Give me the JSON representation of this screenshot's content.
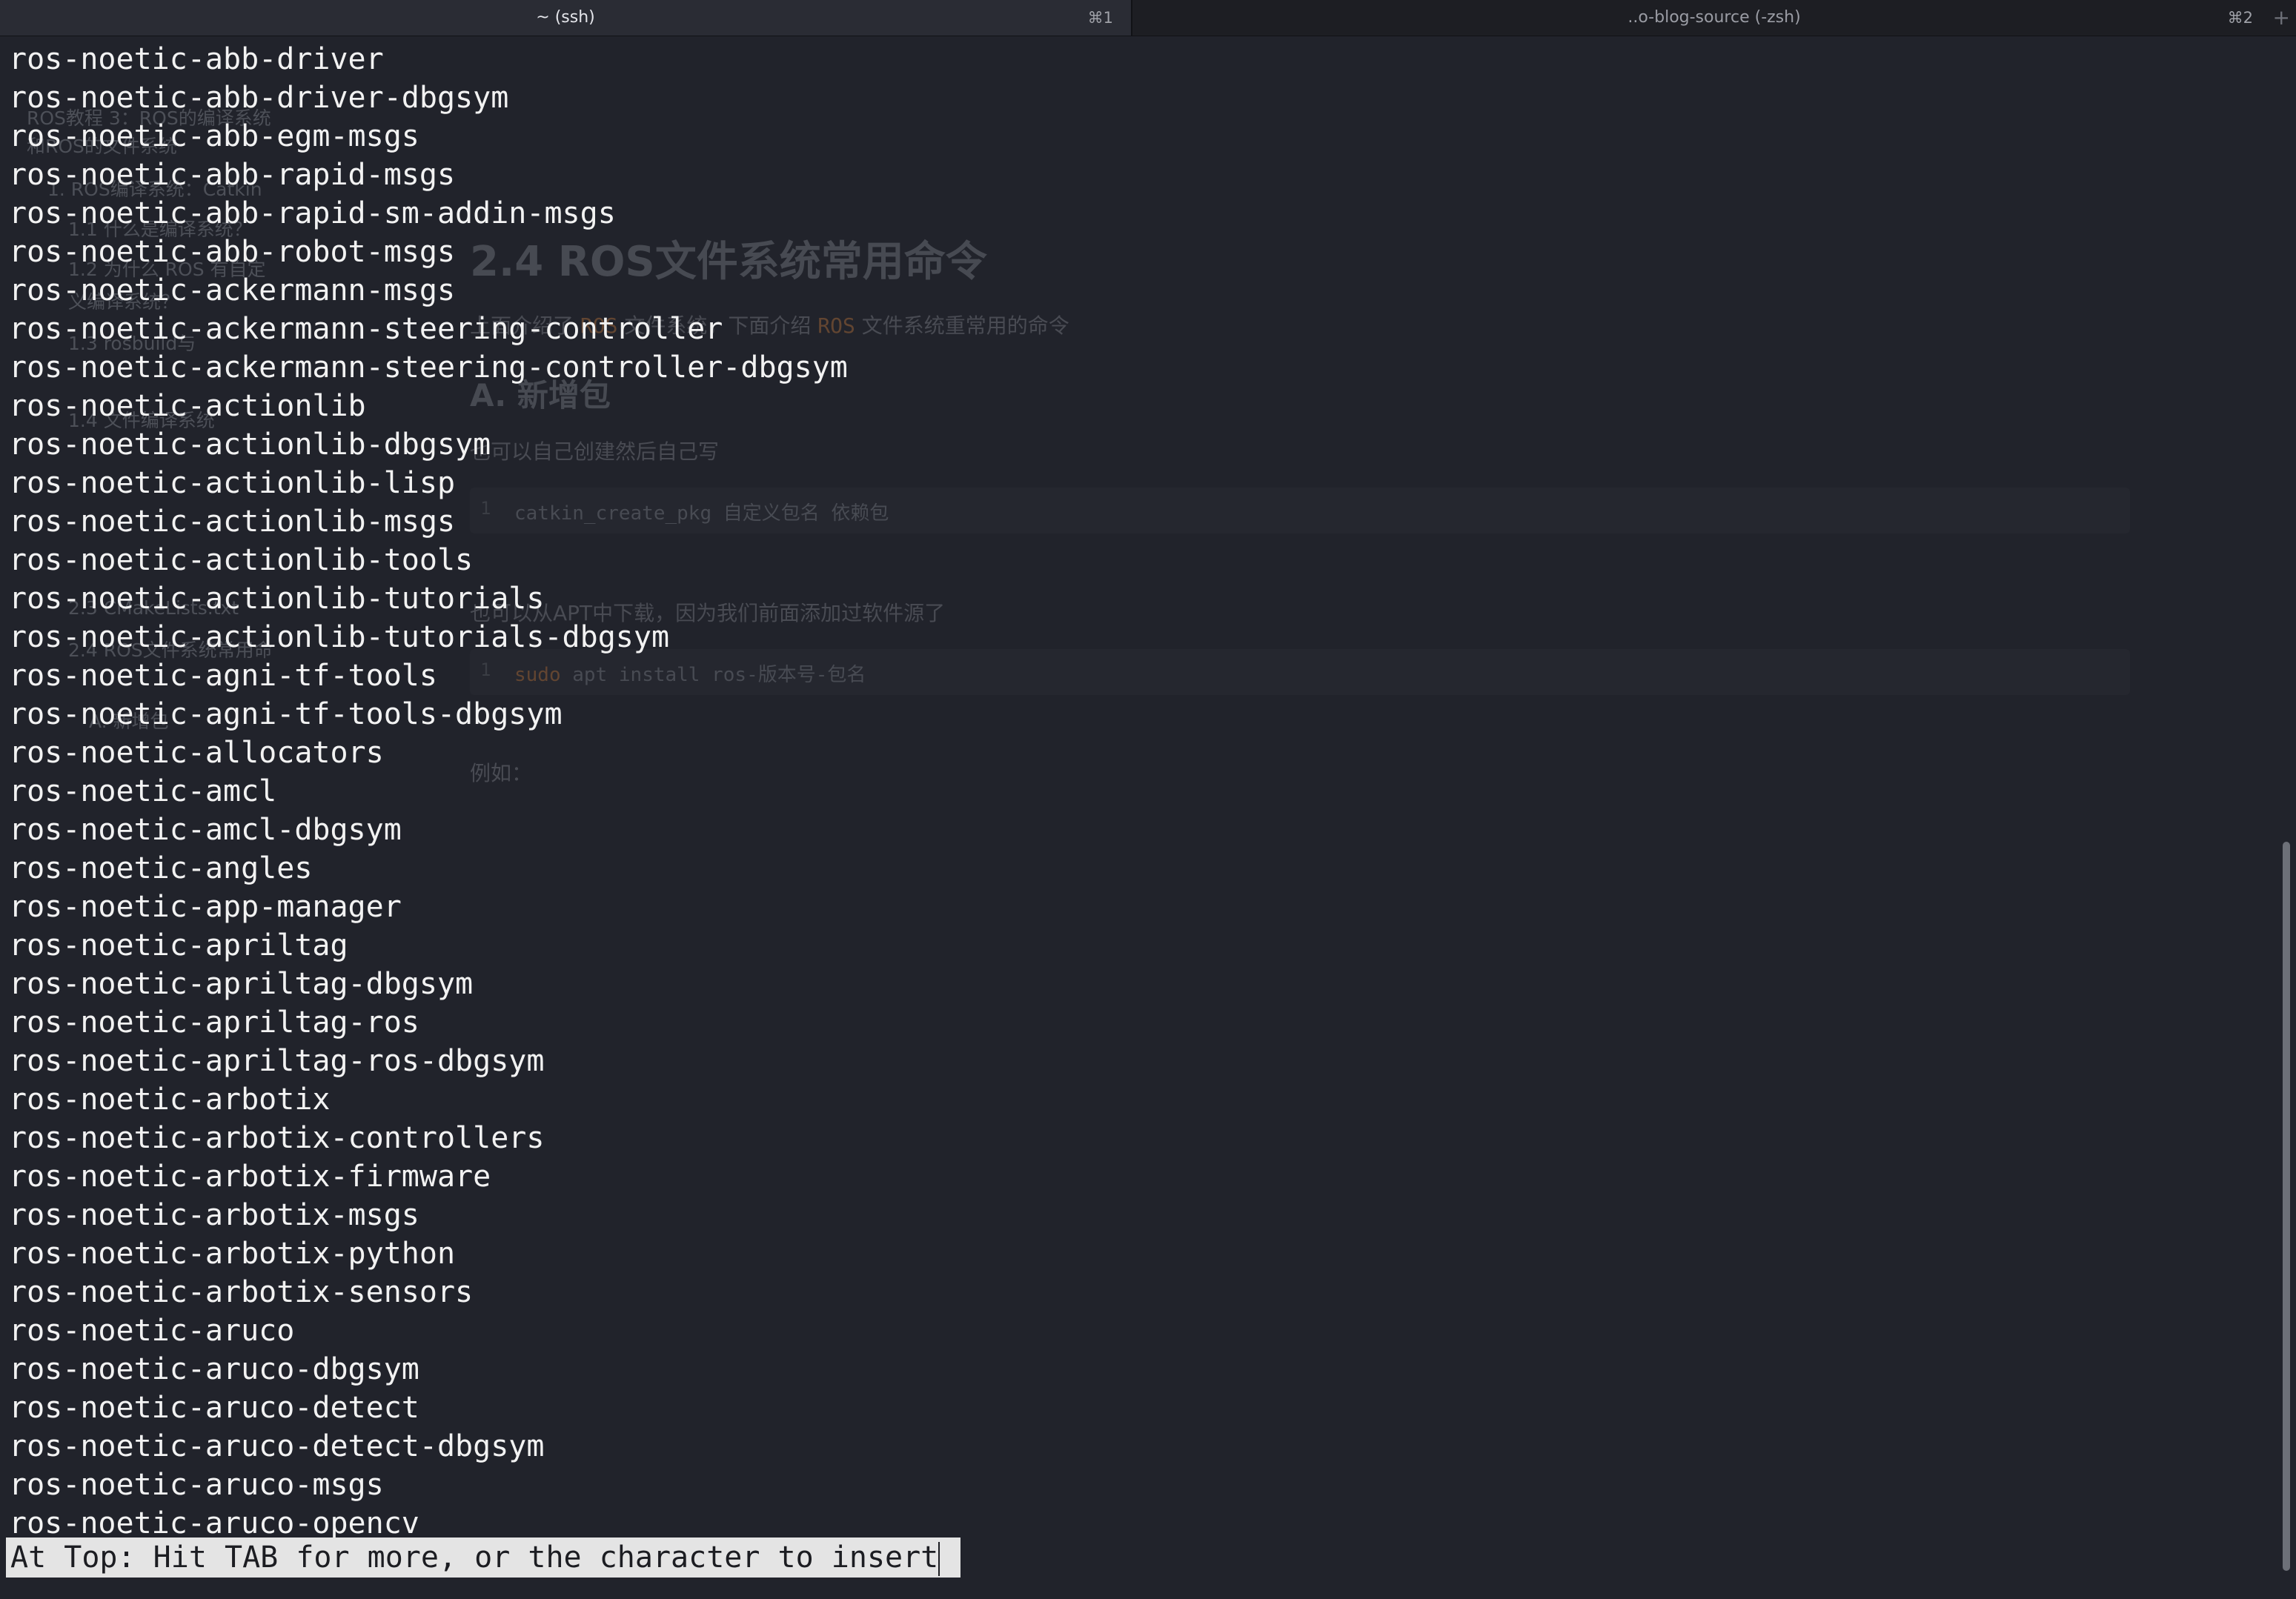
{
  "tabs": [
    {
      "title": "~ (ssh)",
      "shortcut": "⌘1",
      "active": true
    },
    {
      "title": "..o-blog-source (-zsh)",
      "shortcut": "⌘2",
      "active": false
    }
  ],
  "new_tab_label": "+",
  "background_doc": {
    "toc": [
      "ROS教程 3：ROS的编译系统",
      "和ROS的文件系统",
      "1. ROS编译系统：Catkin",
      "1.1 什么是编译系统？",
      "1.2 为什么 ROS 有自定",
      "义编译系统？",
      "1.3 rosbuild与",
      "1.4 文件编译系统",
      "2.3 CMakeLists.txt",
      "2.4 ROS文件系统常用命",
      "A. 新增包"
    ],
    "heading": "2.4 ROS文件系统常用命令",
    "intro_prefix": "上面介绍了 ",
    "intro_ros1": "ROS",
    "intro_middle": " 文件系统，下面介绍 ",
    "intro_ros2": "ROS",
    "intro_suffix": " 文件系统重常用的命令",
    "subheading": "A. 新增包",
    "para1": "也可以自己创建然后自己写",
    "code1_line": "1",
    "code1": "catkin_create_pkg 自定义包名 依赖包",
    "para2": "也可以从APT中下载，因为我们前面添加过软件源了",
    "code2_line": "1",
    "code2_kw": "sudo",
    "code2_rest": " apt install ros-版本号-包名",
    "para3": "例如："
  },
  "terminal": {
    "lines": [
      "ros-noetic-abb-driver",
      "ros-noetic-abb-driver-dbgsym",
      "ros-noetic-abb-egm-msgs",
      "ros-noetic-abb-rapid-msgs",
      "ros-noetic-abb-rapid-sm-addin-msgs",
      "ros-noetic-abb-robot-msgs",
      "ros-noetic-ackermann-msgs",
      "ros-noetic-ackermann-steering-controller",
      "ros-noetic-ackermann-steering-controller-dbgsym",
      "ros-noetic-actionlib",
      "ros-noetic-actionlib-dbgsym",
      "ros-noetic-actionlib-lisp",
      "ros-noetic-actionlib-msgs",
      "ros-noetic-actionlib-tools",
      "ros-noetic-actionlib-tutorials",
      "ros-noetic-actionlib-tutorials-dbgsym",
      "ros-noetic-agni-tf-tools",
      "ros-noetic-agni-tf-tools-dbgsym",
      "ros-noetic-allocators",
      "ros-noetic-amcl",
      "ros-noetic-amcl-dbgsym",
      "ros-noetic-angles",
      "ros-noetic-app-manager",
      "ros-noetic-apriltag",
      "ros-noetic-apriltag-dbgsym",
      "ros-noetic-apriltag-ros",
      "ros-noetic-apriltag-ros-dbgsym",
      "ros-noetic-arbotix",
      "ros-noetic-arbotix-controllers",
      "ros-noetic-arbotix-firmware",
      "ros-noetic-arbotix-msgs",
      "ros-noetic-arbotix-python",
      "ros-noetic-arbotix-sensors",
      "ros-noetic-aruco",
      "ros-noetic-aruco-dbgsym",
      "ros-noetic-aruco-detect",
      "ros-noetic-aruco-detect-dbgsym",
      "ros-noetic-aruco-msgs",
      "ros-noetic-aruco-opencv"
    ],
    "status": "At Top: Hit TAB for more, or the character to insert"
  },
  "colors": {
    "background": "#21232b",
    "foreground": "#f2f2f2",
    "status_bg": "#e4e4e4",
    "accent_orange": "#6e4b33"
  }
}
